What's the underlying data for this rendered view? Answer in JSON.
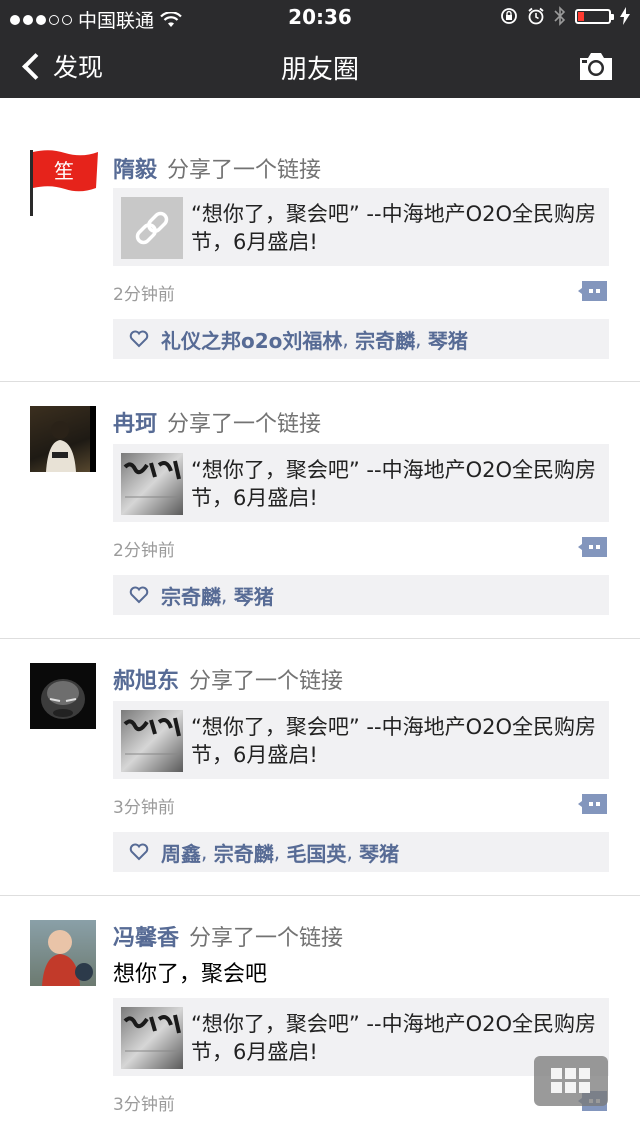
{
  "status_bar": {
    "carrier": "中国联通",
    "time": "20:36"
  },
  "nav": {
    "back_label": "发现",
    "title": "朋友圈"
  },
  "posts": [
    {
      "name": "隋毅",
      "action": "分享了一个链接",
      "avatar_text": "笙",
      "text": "",
      "link_text": "“想你了，聚会吧” --中海地产O2O全民购房节，6月盛启!",
      "time": "2分钟前",
      "likes": [
        "礼仪之邦o2o刘福林",
        "宗奇麟",
        "琴猪"
      ]
    },
    {
      "name": "冉珂",
      "action": "分享了一个链接",
      "text": "",
      "link_text": "“想你了，聚会吧” --中海地产O2O全民购房节，6月盛启!",
      "time": "2分钟前",
      "likes": [
        "宗奇麟",
        "琴猪"
      ]
    },
    {
      "name": "郝旭东",
      "action": "分享了一个链接",
      "text": "",
      "link_text": "“想你了，聚会吧” --中海地产O2O全民购房节，6月盛启!",
      "time": "3分钟前",
      "likes": [
        "周鑫",
        "宗奇麟",
        "毛国英",
        "琴猪"
      ]
    },
    {
      "name": "冯馨香",
      "action": "分享了一个链接",
      "text": "想你了，聚会吧",
      "link_text": "“想你了，聚会吧” --中海地产O2O全民购房节，6月盛启!",
      "time": "3分钟前",
      "likes": []
    }
  ],
  "colors": {
    "bar_bg": "#2b2b2d",
    "name_link": "#576b95",
    "card_bg": "#f1f1f3"
  }
}
